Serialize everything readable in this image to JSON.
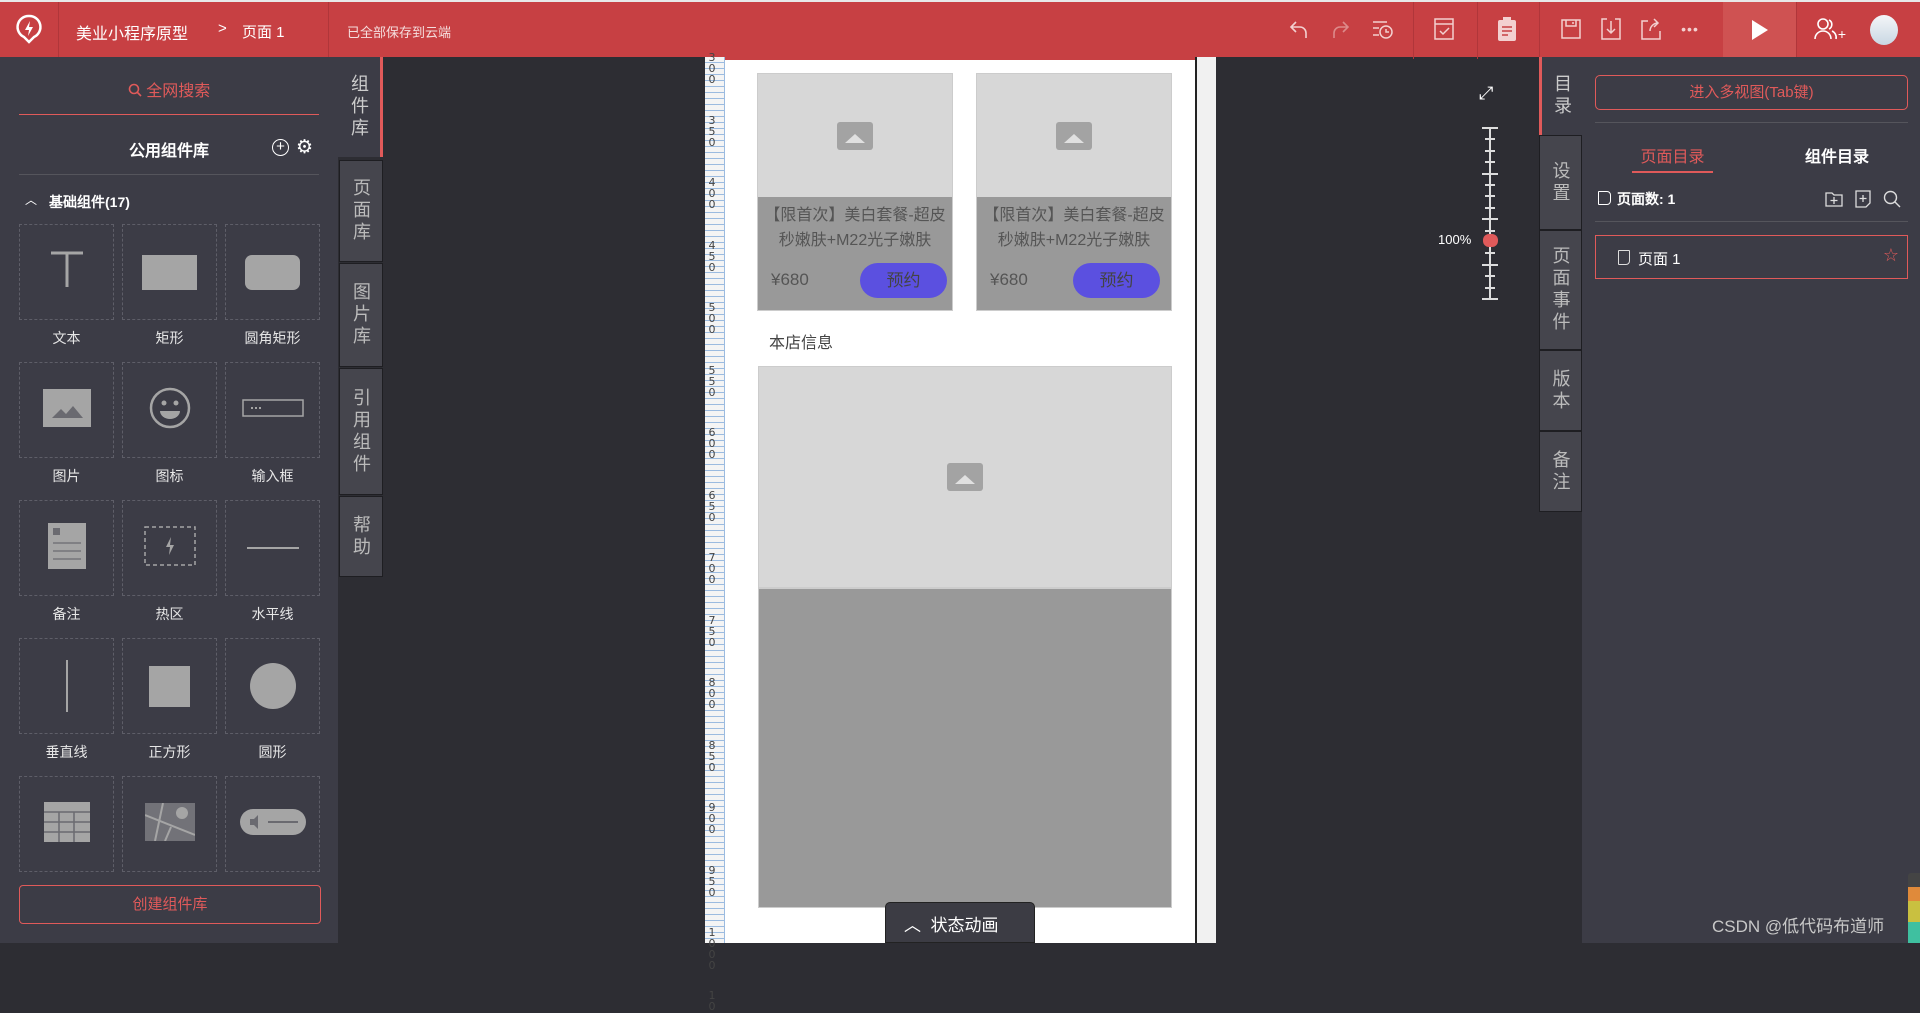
{
  "topbar": {
    "project": "美业小程序原型",
    "separator": ">",
    "page": "页面 1",
    "status": "已全部保存到云端",
    "icons": [
      "undo-icon",
      "redo-icon",
      "history-icon",
      "check-icon",
      "clipboard-icon",
      "save-icon",
      "download-icon",
      "share-icon",
      "more-icon",
      "play-icon",
      "add-user-icon",
      "avatar"
    ],
    "more": "•••",
    "add_user_plus": "+"
  },
  "left": {
    "search": "全网搜索",
    "library_title": "公用组件库",
    "group": "基础组件(17)",
    "create": "创建组件库",
    "components": [
      {
        "label": "文本",
        "icon": "text-icon"
      },
      {
        "label": "矩形",
        "icon": "rectangle-icon"
      },
      {
        "label": "圆角矩形",
        "icon": "rounded-rectangle-icon"
      },
      {
        "label": "图片",
        "icon": "image-icon"
      },
      {
        "label": "图标",
        "icon": "smiley-icon"
      },
      {
        "label": "输入框",
        "icon": "input-icon"
      },
      {
        "label": "备注",
        "icon": "note-icon"
      },
      {
        "label": "热区",
        "icon": "hotspot-icon"
      },
      {
        "label": "水平线",
        "icon": "horizontal-line-icon"
      },
      {
        "label": "垂直线",
        "icon": "vertical-line-icon"
      },
      {
        "label": "正方形",
        "icon": "square-icon"
      },
      {
        "label": "圆形",
        "icon": "circle-icon"
      },
      {
        "label": "",
        "icon": "table-icon"
      },
      {
        "label": "",
        "icon": "map-icon"
      },
      {
        "label": "",
        "icon": "audio-icon"
      }
    ],
    "tabs": [
      "组件库",
      "页面库",
      "图片库",
      "引用组件",
      "帮助"
    ]
  },
  "canvas": {
    "ruler": [
      "300",
      "350",
      "400",
      "450",
      "500",
      "550",
      "600",
      "650",
      "700",
      "750",
      "800",
      "850",
      "900",
      "950",
      "1000",
      "10"
    ],
    "cards": [
      {
        "title": "【限首次】美白套餐-超皮秒嫩肤+M22光子嫩肤",
        "price": "¥680",
        "button": "预约"
      },
      {
        "title": "【限首次】美白套餐-超皮秒嫩肤+M22光子嫩肤",
        "price": "¥680",
        "button": "预约"
      }
    ],
    "section": "本店信息",
    "state_anim": "状态动画",
    "zoom": "100%",
    "zoom_level": 1.0
  },
  "right": {
    "tabs": [
      "目录",
      "设置",
      "页面事件",
      "版本",
      "备注"
    ],
    "multiview": "进入多视图(Tab键)",
    "subtabs": [
      "页面目录",
      "组件目录"
    ],
    "page_count": "页面数: 1",
    "pages": [
      "页面 1"
    ]
  },
  "watermark": "CSDN @低代码布道师",
  "colors": {
    "accent": "#e05a5a",
    "topbar": "#c74043",
    "button": "#5b50e0"
  }
}
